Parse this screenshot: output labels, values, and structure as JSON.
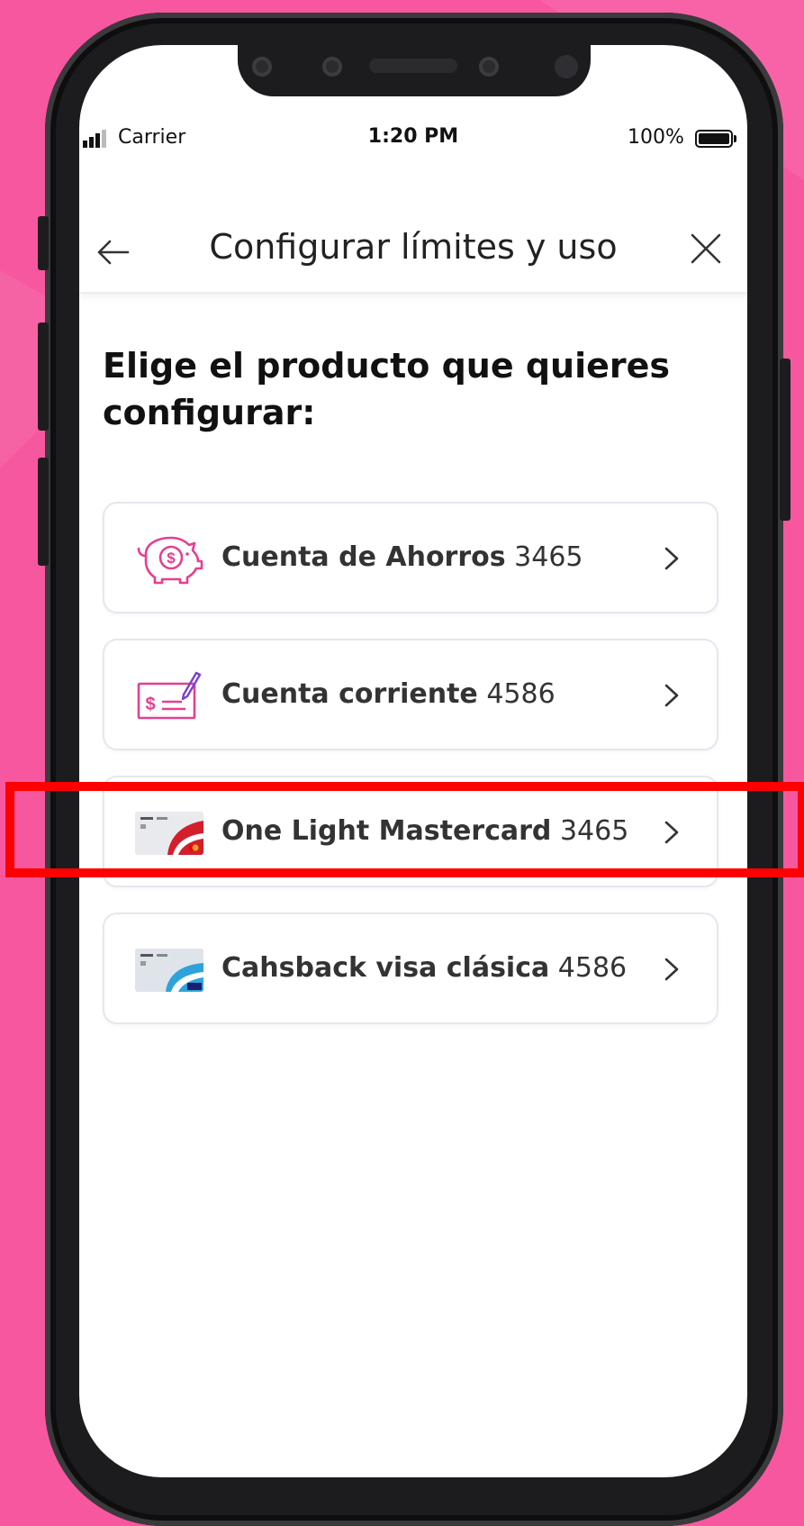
{
  "status_bar": {
    "carrier": "Carrier",
    "time": "1:20 PM",
    "battery": "100%"
  },
  "header": {
    "title": "Configurar límites y uso",
    "back_icon": "arrow-left-icon",
    "close_icon": "close-icon"
  },
  "heading": "Elige el producto que quieres configurar:",
  "products": [
    {
      "name": "Cuenta de Ahorros",
      "number": "3465",
      "icon": "piggy-bank-icon"
    },
    {
      "name": "Cuenta corriente",
      "number": "4586",
      "icon": "check-signing-icon"
    },
    {
      "name": "One Light Mastercard",
      "number": "3465",
      "icon": "mastercard-card-image",
      "highlighted": true
    },
    {
      "name": "Cahsback visa clásica",
      "number": "4586",
      "icon": "visa-card-image"
    }
  ],
  "colors": {
    "background": "#f7579f",
    "accent": "#e5408f",
    "highlight": "#ff0000",
    "icon_purple": "#7b3fd1"
  }
}
